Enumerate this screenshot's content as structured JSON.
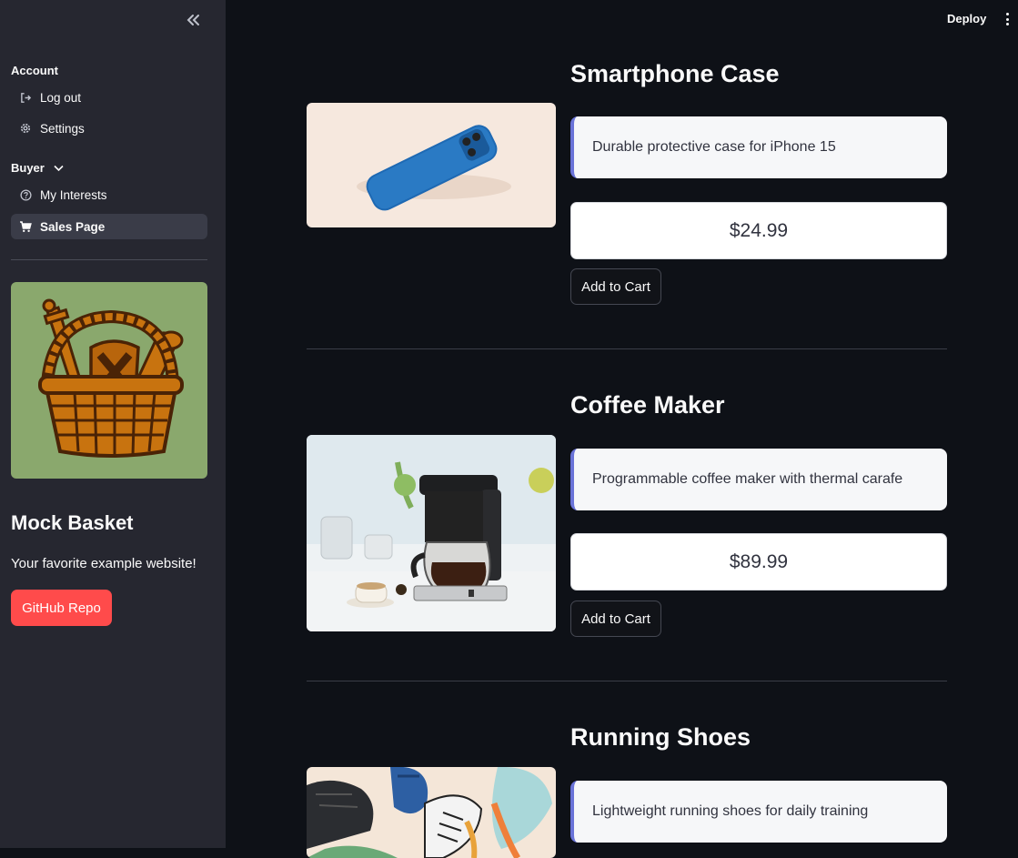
{
  "header": {
    "deploy_label": "Deploy"
  },
  "sidebar": {
    "sections": [
      {
        "label": "Account",
        "items": [
          {
            "label": "Log out",
            "icon": "logout-icon"
          },
          {
            "label": "Settings",
            "icon": "gear-icon"
          }
        ]
      },
      {
        "label": "Buyer",
        "expanded": true,
        "items": [
          {
            "label": "My Interests",
            "icon": "question-circle-icon"
          },
          {
            "label": "Sales Page",
            "icon": "shopping-cart-icon",
            "active": true
          }
        ]
      }
    ],
    "brand": {
      "title": "Mock Basket",
      "tagline": "Your favorite example website!",
      "button_label": "GitHub Repo",
      "logo_bg": "#8aa86d"
    }
  },
  "products": [
    {
      "title": "Smartphone Case",
      "description": "Durable protective case for iPhone 15",
      "price": "$24.99",
      "cart_label": "Add to Cart"
    },
    {
      "title": "Coffee Maker",
      "description": "Programmable coffee maker with thermal carafe",
      "price": "$89.99",
      "cart_label": "Add to Cart"
    },
    {
      "title": "Running Shoes",
      "description": "Lightweight running shoes for daily training",
      "price": "",
      "cart_label": ""
    }
  ],
  "colors": {
    "app_bg": "#0e1117",
    "sidebar_bg": "#262730",
    "accent_red": "#ff4b4b",
    "desc_border": "#6a73d8"
  }
}
